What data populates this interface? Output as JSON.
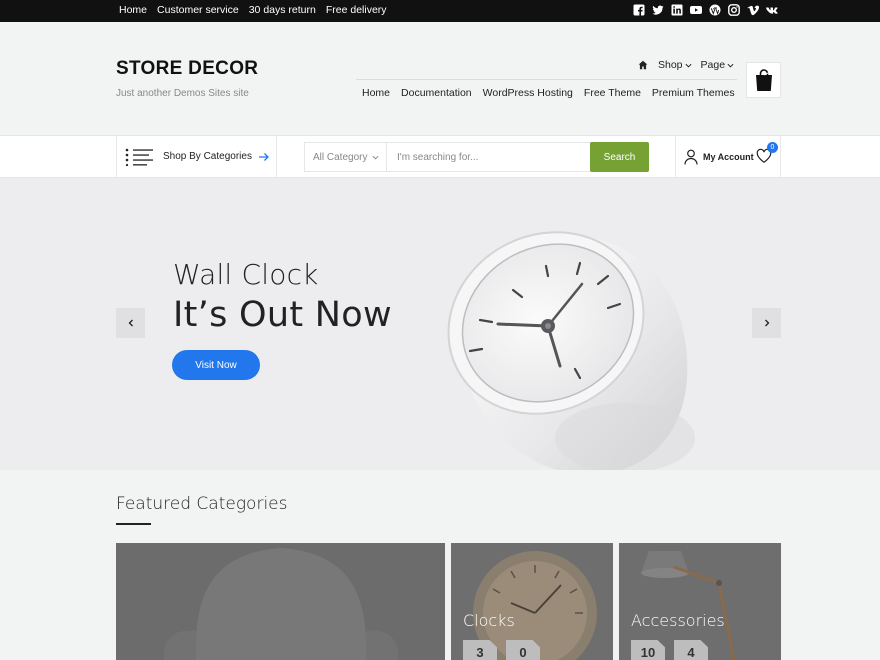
{
  "topbar": {
    "links": [
      "Home",
      "Customer service",
      "30 days return",
      "Free delivery"
    ],
    "social_icons": [
      "facebook-icon",
      "twitter-icon",
      "linkedin-icon",
      "youtube-icon",
      "wordpress-icon",
      "instagram-icon",
      "vimeo-icon",
      "vk-icon"
    ]
  },
  "header": {
    "site_title": "STORE DECOR",
    "tagline": "Just another Demos Sites site",
    "top_menu": [
      "Shop",
      "Page"
    ],
    "main_menu": [
      "Home",
      "Documentation",
      "WordPress Hosting",
      "Free Theme",
      "Premium Themes"
    ]
  },
  "searchbar": {
    "categories_label": "Shop By Categories",
    "category_select": "All Category",
    "placeholder": "I'm searching for...",
    "button_label": "Search",
    "account_label": "My Account",
    "wishlist_count": "0"
  },
  "hero": {
    "subtitle": "Wall Clock",
    "title": "It’s Out Now",
    "button_label": "Visit Now"
  },
  "featured": {
    "title": "Featured Categories",
    "cards": [
      {
        "name": "",
        "counts": []
      },
      {
        "name": "Clocks",
        "counts": [
          "3",
          "0"
        ]
      },
      {
        "name": "Accessories",
        "counts": [
          "10",
          "4"
        ]
      }
    ]
  },
  "colors": {
    "accent_blue": "#2377ec",
    "search_green": "#76a234",
    "topbar_bg": "#111111"
  }
}
